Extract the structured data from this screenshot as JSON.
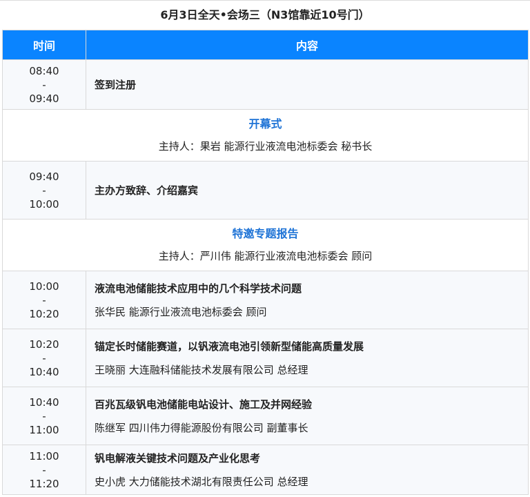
{
  "title": "6月3日全天•会场三（N3馆靠近10号门）",
  "headers": {
    "time": "时间",
    "content": "内容"
  },
  "rows": [
    {
      "start": "08:40",
      "sep": "-",
      "end": "09:40",
      "title": "签到注册"
    },
    {
      "section": "开幕式",
      "host": "主持人：果岩  能源行业液流电池标委会  秘书长"
    },
    {
      "start": "09:40",
      "sep": "-",
      "end": "10:00",
      "title": "主办方致辞、介绍嘉宾"
    },
    {
      "section": "特邀专题报告",
      "host": "主持人：严川伟  能源行业液流电池标委会  顾问"
    },
    {
      "start": "10:00",
      "sep": "-",
      "end": "10:20",
      "title": "液流电池储能技术应用中的几个科学技术问题",
      "speaker": "张华民  能源行业液流电池标委会  顾问"
    },
    {
      "start": "10:20",
      "sep": "-",
      "end": "10:40",
      "title": "锚定长时储能赛道，以钒液流电池引领新型储能高质量发展",
      "speaker": "王晓丽  大连融科储能技术发展有限公司  总经理"
    },
    {
      "start": "10:40",
      "sep": "-",
      "end": "11:00",
      "title": "百兆瓦级钒电池储能电站设计、施工及并网经验",
      "speaker": "陈继军  四川伟力得能源股份有限公司  副董事长"
    },
    {
      "start": "11:00",
      "sep": "-",
      "end": "11:20",
      "title": "钒电解液关键技术问题及产业化思考",
      "speaker": "史小虎  大力储能技术湖北有限责任公司  总经理"
    }
  ]
}
